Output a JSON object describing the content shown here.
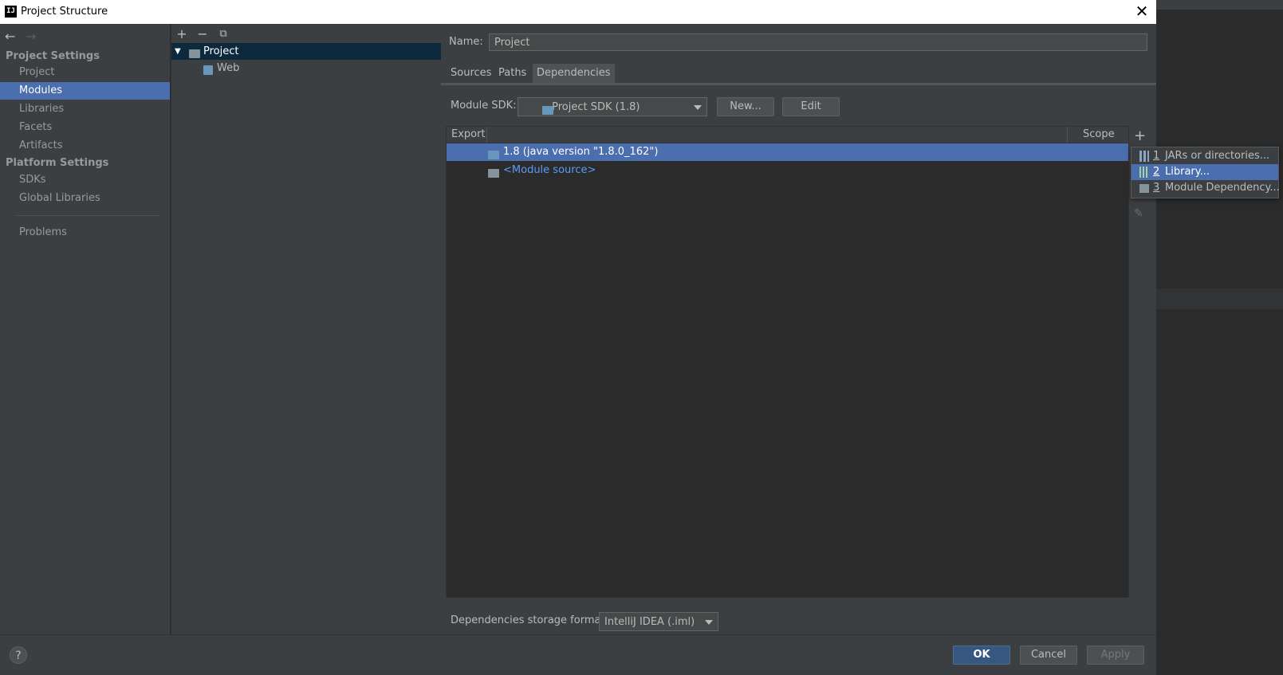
{
  "window": {
    "title": "Project Structure",
    "app_icon_text": "IJ",
    "close_glyph": "✕"
  },
  "nav": {
    "back_glyph": "←",
    "forward_glyph": "→",
    "sections": [
      {
        "title": "Project Settings",
        "items": [
          "Project",
          "Modules",
          "Libraries",
          "Facets",
          "Artifacts"
        ]
      },
      {
        "title": "Platform Settings",
        "items": [
          "SDKs",
          "Global Libraries"
        ]
      }
    ],
    "problems": "Problems",
    "selected": "Modules"
  },
  "tree": {
    "toolbar": {
      "add": "+",
      "remove": "−",
      "copy": "⧉"
    },
    "expand_glyph": "▼",
    "nodes": [
      {
        "label": "Project",
        "level": 0,
        "selected": true
      },
      {
        "label": "Web",
        "level": 1,
        "selected": false
      }
    ]
  },
  "main": {
    "name_label": "Name:",
    "name_value": "Project",
    "tabs": [
      "Sources",
      "Paths",
      "Dependencies"
    ],
    "active_tab": "Dependencies",
    "sdk_label": "Module SDK:",
    "sdk_value": "Project SDK (1.8)",
    "new_button": "New...",
    "edit_button": "Edit",
    "table": {
      "col_export": "Export",
      "col_scope": "Scope",
      "rows": [
        {
          "label": "1.8 (java version \"1.8.0_162\")",
          "selected": true
        },
        {
          "label": "<Module source>",
          "selected": false,
          "color": "#589df6"
        }
      ]
    },
    "side_tools": {
      "add": "+",
      "edit": "✎"
    },
    "storage_label": "Dependencies storage format:",
    "storage_value": "IntelliJ IDEA (.iml)"
  },
  "popup": {
    "items": [
      {
        "num": "1",
        "label": "JARs or directories...",
        "icon": "jar-icon",
        "selected": false
      },
      {
        "num": "2",
        "label": "Library...",
        "icon": "library-icon",
        "selected": true
      },
      {
        "num": "3",
        "label": "Module Dependency...",
        "icon": "module-icon",
        "selected": false
      }
    ]
  },
  "footer": {
    "help": "?",
    "ok": "OK",
    "cancel": "Cancel",
    "apply": "Apply"
  },
  "colors": {
    "selection": "#4b6eaf",
    "panel": "#3c3f41",
    "editor": "#2b2b2b",
    "link": "#589df6"
  }
}
